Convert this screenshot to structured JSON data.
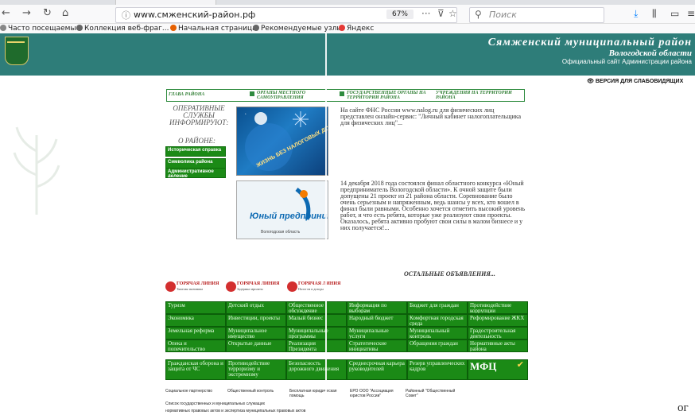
{
  "browser": {
    "url": "www.смженский-район.рф",
    "zoom": "67%",
    "search_placeholder": "Поиск",
    "bookmarks": [
      "Часто посещаемые",
      "Коллекция веб-фраг...",
      "Начальная страница",
      "Рекомендуемые узлы",
      "Яндекс"
    ]
  },
  "site": {
    "title": "Сямженский муниципальный район",
    "region": "Вологодской области",
    "subtitle": "Официальный сайт Администрации района",
    "vision_button": "ВЕРСИЯ ДЛЯ СЛАБОВИДЯЩИХ"
  },
  "topmenu": [
    "ГЛАВА РАЙОНА",
    "ОРГАНЫ МЕСТНОГО САМОУПРАВЛЕНИЯ",
    "ГОСУДАРСТВЕННЫЕ ОРГАНЫ НА ТЕРРИТОРИИ РАЙОНА",
    "УЧРЕЖДЕНИЯ НА ТЕРРИТОРИИ РАЙОНА"
  ],
  "sidebar": {
    "ops_title": "ОПЕРАТИВНЫЕ СЛУЖБЫ ИНФОРМИРУЮТ:",
    "about_title": "О РАЙОНЕ:",
    "buttons": [
      "Историческая справка",
      "Символика района",
      "Административное деление"
    ]
  },
  "news": [
    {
      "image_caption": "ЖИЗНЬ БЕЗ НАЛОГОВЫХ ДОЛГОВ",
      "text": "На сайте ФНС России www.nalog.ru для физических лиц представлен онлайн-сервис: \"Личный кабинет налогоплательщика для физических лиц\"..."
    },
    {
      "image_caption": "Юный предприниматель",
      "image_sub": "Вологодская область",
      "text": "14 декабря 2018 года состоялся финал областного конкурса «Юный предприниматель Вологодской области». К очной защите были допущены 21 проект из 21 района области. Соревнование было очень серьезным и напряженным, ведь шансы у всех, кто вошел в финал были равными. Особенно хочется отметить высокий уровень работ, и что есть ребята, которые уже реализуют свои проекты. Оказалось, ребята активно пробуют свои силы в малом бизнесе и у них получается!..."
    }
  ],
  "others_link": "ОСТАЛЬНЫЕ ОБЪЯВЛЕНИЯ...",
  "hotlines": [
    {
      "title": "ГОРЯЧАЯ ЛИНИЯ",
      "sub": "Тяжелая экономика"
    },
    {
      "title": "ГОРЯЧАЯ ЛИНИЯ",
      "sub": "Задержка зарплаты"
    },
    {
      "title": "ГОРЯЧАЯ ЛИНИЯ",
      "sub": "Налог на и доходы"
    }
  ],
  "grid": [
    [
      "Туризм",
      "Детский отдых",
      "Общественное обсуждение",
      "Информация по выборам",
      "Бюджет для граждан",
      "Противодействие коррупции"
    ],
    [
      "Экономика",
      "Инвестиции, проекты",
      "Малый бизнес",
      "Народный бюджет",
      "Комфортная городская среда",
      "Реформирование ЖКХ"
    ],
    [
      "Земельная реформа",
      "Муниципальное имущество",
      "Муниципальные программы",
      "Муниципальные услуги",
      "Муниципальный контроль",
      "Градостроительная деятельность"
    ],
    [
      "Опека и попечительство",
      "Открытые данные",
      "Реализация Президента",
      "Стратегические инициативы Российской Федерации",
      "Обращения граждан",
      "Нормативные акты района"
    ],
    [
      "Гражданская оборона и защита от ЧС",
      "Противодействие терроризму и экстремизму",
      "Безопасность дорожного движения",
      "Среднесрочная карьера руководителей",
      "Резерв управленческих кадров",
      "МФЦ"
    ]
  ],
  "bottom": {
    "items": [
      "Социальное партнерство",
      "Общественный контроль",
      "Бесплатная юридическая помощь",
      "ЕРО ООО \"Ассоциация юристов России\"",
      "Районный \"Общественный Совет\""
    ],
    "footer1": "Список государственных и муниципальных служащих",
    "footer2": "нормативных правовых актов и экспертиза муниципальных правовых актов",
    "bottom_right": "ог"
  }
}
